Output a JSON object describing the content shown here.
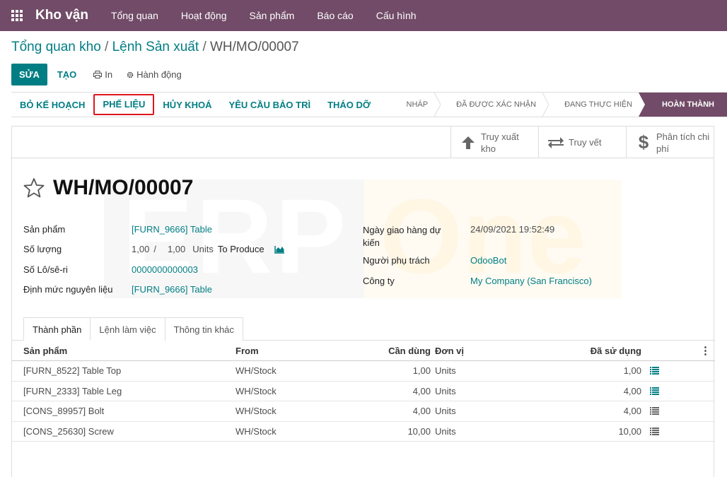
{
  "navbar": {
    "brand": "Kho vận",
    "menu": [
      "Tổng quan",
      "Hoạt động",
      "Sản phẩm",
      "Báo cáo",
      "Cấu hình"
    ]
  },
  "breadcrumb": {
    "part1": "Tổng quan kho",
    "part2": "Lệnh Sản xuất",
    "current": "WH/MO/00007",
    "separator": "/"
  },
  "actions": {
    "edit": "SỬA",
    "create": "TẠO",
    "print": "In",
    "action": "Hành động"
  },
  "statusbar": {
    "buttons": [
      "BỎ KẾ HOẠCH",
      "PHẾ LIỆU",
      "HỦY KHOÁ",
      "YÊU CẦU BẢO TRÌ",
      "THÁO DỠ"
    ],
    "stages": [
      "NHÁP",
      "ĐÃ ĐƯỢC XÁC NHẬN",
      "ĐANG THỰC HIỆN",
      "HOÀN THÀNH"
    ],
    "active_stage": "HOÀN THÀNH"
  },
  "smart_buttons": {
    "traceability_line1": "Truy xuất",
    "traceability_line2": "kho",
    "trace": "Truy vết",
    "cost_line1": "Phân tích chi",
    "cost_line2": "phí"
  },
  "watermark": {
    "left": "ERP",
    "right": "One"
  },
  "record": {
    "title": "WH/MO/00007",
    "fields": {
      "product_label": "Sản phẩm",
      "product_value": "[FURN_9666] Table",
      "qty_label": "Số lượng",
      "qty_done": "1,00",
      "qty_sep": "/",
      "qty_total": "1,00",
      "qty_unit": "Units",
      "qty_to_produce": "To Produce",
      "lot_label": "Số Lô/sê-ri",
      "lot_value": "0000000000003",
      "bom_label": "Định mức nguyên liệu",
      "bom_value": "[FURN_9666] Table",
      "deadline_label_line1": "Ngày giao hàng dự",
      "deadline_label_line2": "kiến",
      "deadline_value": "24/09/2021 19:52:49",
      "responsible_label": "Người phụ trách",
      "responsible_value": "OdooBot",
      "company_label": "Công ty",
      "company_value": "My Company (San Francisco)"
    }
  },
  "tabs": [
    "Thành phần",
    "Lệnh làm việc",
    "Thông tin khác"
  ],
  "table": {
    "headers": {
      "product": "Sản phẩm",
      "from": "From",
      "need": "Cần dùng",
      "unit": "Đơn vị",
      "used": "Đã sử dụng"
    },
    "rows": [
      {
        "product": "[FURN_8522] Table Top",
        "from": "WH/Stock",
        "need": "1,00",
        "unit": "Units",
        "used": "1,00",
        "icon_color": "#017e84"
      },
      {
        "product": "[FURN_2333] Table Leg",
        "from": "WH/Stock",
        "need": "4,00",
        "unit": "Units",
        "used": "4,00",
        "icon_color": "#017e84"
      },
      {
        "product": "[CONS_89957] Bolt",
        "from": "WH/Stock",
        "need": "4,00",
        "unit": "Units",
        "used": "4,00",
        "icon_color": "#666666"
      },
      {
        "product": "[CONS_25630] Screw",
        "from": "WH/Stock",
        "need": "10,00",
        "unit": "Units",
        "used": "10,00",
        "icon_color": "#666666"
      }
    ]
  },
  "colors": {
    "brand": "#714b67",
    "accent": "#017e84",
    "highlight": "#e0141e"
  }
}
